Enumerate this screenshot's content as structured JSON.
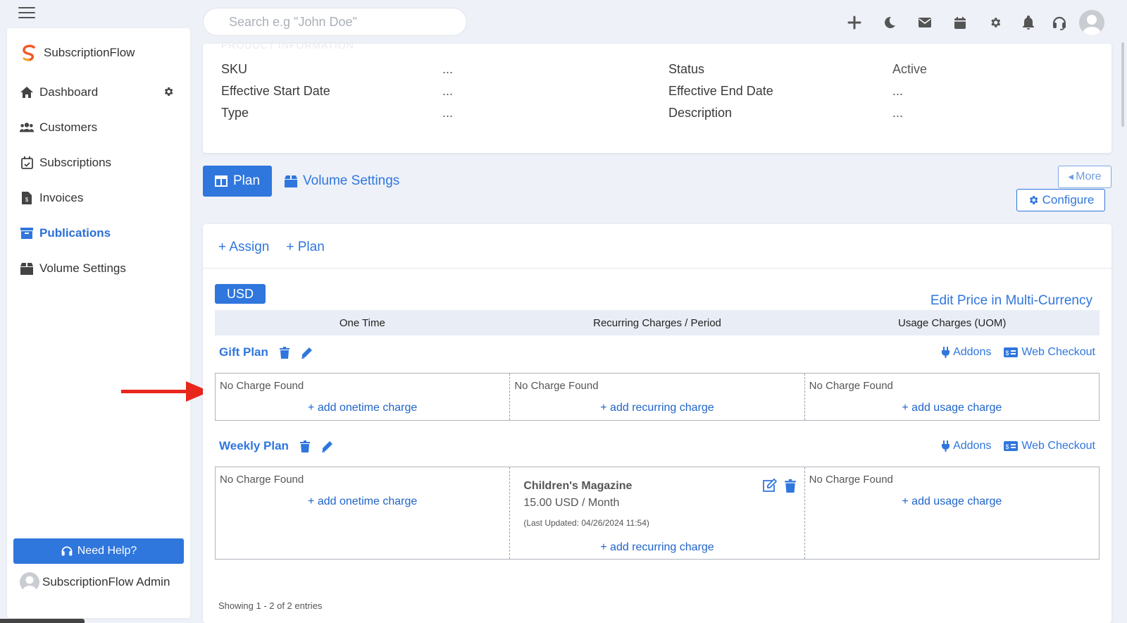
{
  "topbar": {
    "search_placeholder": "Search e.g \"John Doe\"",
    "icons": [
      "plus-icon",
      "moon-icon",
      "mail-icon",
      "calendar-icon",
      "gear-icon",
      "bell-icon",
      "headset-icon",
      "user-avatar"
    ]
  },
  "brand": {
    "name": "SubscriptionFlow"
  },
  "sidebar": {
    "items": [
      {
        "label": "Dashboard",
        "icon": "home-icon"
      },
      {
        "label": "Customers",
        "icon": "users-icon"
      },
      {
        "label": "Subscriptions",
        "icon": "calendar-check-icon"
      },
      {
        "label": "Invoices",
        "icon": "invoice-icon"
      },
      {
        "label": "Publications",
        "icon": "archive-icon",
        "active": true
      },
      {
        "label": "Volume Settings",
        "icon": "box-icon"
      }
    ],
    "need_help": "Need Help?",
    "admin_name": "SubscriptionFlow Admin"
  },
  "product_info": {
    "section_title": "PRODUCT INFORMATION",
    "left": [
      {
        "label": "SKU",
        "value": "..."
      },
      {
        "label": "Effective Start Date",
        "value": "..."
      },
      {
        "label": "Type",
        "value": "..."
      }
    ],
    "right": [
      {
        "label": "Status",
        "value": "Active"
      },
      {
        "label": "Effective End Date",
        "value": "..."
      },
      {
        "label": "Description",
        "value": "..."
      }
    ]
  },
  "tabs": {
    "plan": "Plan",
    "volume_settings": "Volume Settings",
    "more": "More",
    "configure": "Configure"
  },
  "plans_card": {
    "assign": "+ Assign",
    "add_plan": "+ Plan",
    "currency": "USD",
    "edit_price": "Edit Price in Multi-Currency",
    "columns": [
      "One Time",
      "Recurring Charges / Period",
      "Usage Charges (UOM)"
    ],
    "addons_label": "Addons",
    "web_checkout_label": "Web Checkout",
    "no_charge": "No Charge Found",
    "add_onetime": "+ add onetime charge",
    "add_recurring": "+ add recurring charge",
    "add_usage": "+ add usage charge",
    "plans": [
      {
        "name": "Gift Plan"
      },
      {
        "name": "Weekly Plan",
        "recurring_charge": {
          "title": "Children's Magazine",
          "price": "15.00 USD / Month",
          "updated": "(Last Updated: 04/26/2024 11:54)"
        }
      }
    ],
    "showing": "Showing 1 - 2 of 2 entries"
  },
  "colors": {
    "primary": "#2f76dd",
    "arrow": "#e8261c",
    "background": "#eef1f8"
  }
}
